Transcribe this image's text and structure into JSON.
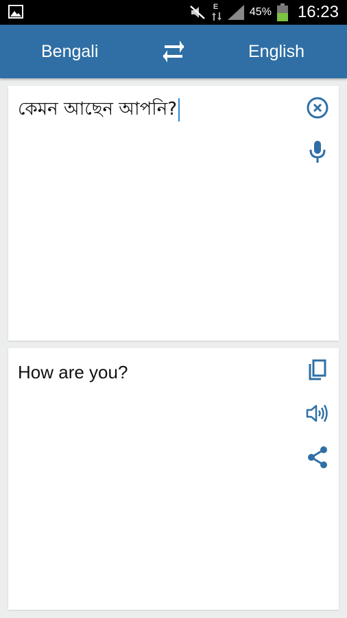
{
  "status_bar": {
    "network_type": "E",
    "battery_percent": "45%",
    "time": "16:23",
    "icons": [
      "gallery-notification-icon",
      "mute-icon",
      "data-arrows-icon",
      "signal-icon",
      "battery-icon"
    ]
  },
  "app_bar": {
    "source_language": "Bengali",
    "target_language": "English",
    "swap_icon": "swap-arrows-icon",
    "background_color": "#2f6fa5"
  },
  "input_card": {
    "text": "কেমন আছেন আপনি?",
    "icons": [
      "clear-icon",
      "microphone-icon"
    ]
  },
  "output_card": {
    "text": "How are you?",
    "icons": [
      "copy-icon",
      "speaker-icon",
      "share-icon"
    ]
  },
  "colors": {
    "accent": "#2f6fa5",
    "icon": "#2f6fa5",
    "caret": "#2f86d0",
    "background": "#eceeee"
  }
}
